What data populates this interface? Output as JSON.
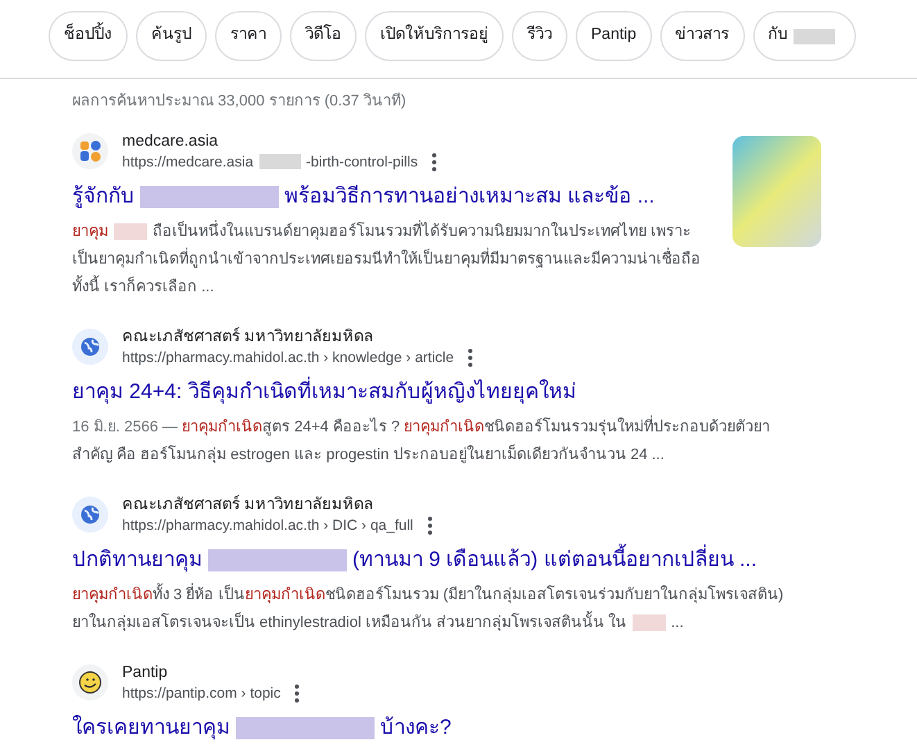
{
  "chips": [
    {
      "parts": [
        {
          "kind": "text",
          "text": "ช็อปปิ้ง"
        }
      ]
    },
    {
      "parts": [
        {
          "kind": "text",
          "text": "ค้นรูป"
        }
      ]
    },
    {
      "parts": [
        {
          "kind": "text",
          "text": "ราคา"
        }
      ]
    },
    {
      "parts": [
        {
          "kind": "text",
          "text": "วิดีโอ"
        }
      ]
    },
    {
      "parts": [
        {
          "kind": "text",
          "text": "เปิดให้บริการอยู่"
        }
      ]
    },
    {
      "parts": [
        {
          "kind": "text",
          "text": "รีวิว"
        }
      ]
    },
    {
      "parts": [
        {
          "kind": "text",
          "text": "Pantip"
        }
      ]
    },
    {
      "parts": [
        {
          "kind": "text",
          "text": "ข่าวสาร"
        }
      ]
    },
    {
      "parts": [
        {
          "kind": "text",
          "text": "กับ"
        },
        {
          "kind": "redacted"
        }
      ]
    }
  ],
  "result_stats": "ผลการค้นหาประมาณ 33,000 รายการ (0.37 วินาที)",
  "results": [
    {
      "kind": "pill",
      "site": "medcare.asia",
      "url": [
        {
          "kind": "text",
          "text": "https://medcare.asia"
        },
        {
          "kind": "redacted"
        },
        {
          "kind": "text",
          "text": "-birth-control-pills"
        }
      ],
      "thumbnail": true,
      "title": [
        {
          "kind": "text",
          "text": "รู้จักกับ"
        },
        {
          "kind": "redacted"
        },
        {
          "kind": "text",
          "text": "พร้อมวิธีการทานอย่างเหมาะสม และข้อ ..."
        }
      ],
      "snippet": [
        {
          "kind": "highlight",
          "text": "ยาคุม"
        },
        {
          "kind": "redacted"
        },
        {
          "kind": "text",
          "text": "ถือเป็นหนึ่งในแบรนด์ยาคุมฮอร์โมนรวมที่ได้รับความนิยมมากในประเทศไทย เพราะเป็นยาคุมกำเนิดที่ถูกนำเข้าจากประเทศเยอรมนีทำให้เป็นยาคุมที่มีมาตรฐานและมีความน่าเชื่อถือ ทั้งนี้ เราก็ควรเลือก ..."
        }
      ]
    },
    {
      "kind": "globe",
      "site": "คณะเภสัชศาสตร์ มหาวิทยาลัยมหิดล",
      "url": [
        {
          "kind": "text",
          "text": "https://pharmacy.mahidol.ac.th › knowledge › article"
        }
      ],
      "thumbnail": false,
      "title": [
        {
          "kind": "text",
          "text": "ยาคุม 24+4: วิธีคุมกำเนิดที่เหมาะสมกับผู้หญิงไทยยุคใหม่"
        }
      ],
      "snippet": [
        {
          "kind": "date",
          "text": "16 มิ.ย. 2566 — "
        },
        {
          "kind": "highlight",
          "text": "ยาคุมกำเนิด"
        },
        {
          "kind": "text",
          "text": "สูตร 24+4 คืออะไร ? "
        },
        {
          "kind": "highlight",
          "text": "ยาคุมกำเนิด"
        },
        {
          "kind": "text",
          "text": "ชนิดฮอร์โมนรวมรุ่นใหม่ที่ประกอบด้วยตัวยาสำคัญ คือ ฮอร์โมนกลุ่ม estrogen และ progestin ประกอบอยู่ในยาเม็ดเดียวกันจำนวน 24 ..."
        }
      ]
    },
    {
      "kind": "globe",
      "site": "คณะเภสัชศาสตร์ มหาวิทยาลัยมหิดล",
      "url": [
        {
          "kind": "text",
          "text": "https://pharmacy.mahidol.ac.th › DIC › qa_full"
        }
      ],
      "thumbnail": false,
      "title": [
        {
          "kind": "text",
          "text": "ปกติทานยาคุม"
        },
        {
          "kind": "redacted"
        },
        {
          "kind": "text",
          "text": "(ทานมา 9 เดือนแล้ว) แต่ตอนนี้อยากเปลี่ยน ..."
        }
      ],
      "snippet": [
        {
          "kind": "highlight",
          "text": "ยาคุมกำเนิด"
        },
        {
          "kind": "text",
          "text": "ทั้ง 3 ยี่ห้อ เป็น"
        },
        {
          "kind": "highlight",
          "text": "ยาคุมกำเนิด"
        },
        {
          "kind": "text",
          "text": "ชนิดฮอร์โมนรวม (มียาในกลุ่มเอสโตรเจนร่วมกับยาในกลุ่มโพรเจสติน) ยาในกลุ่มเอสโตรเจนจะเป็น ethinylestradiol เหมือนกัน ส่วนยากลุ่มโพรเจสตินนั้น ใน"
        },
        {
          "kind": "redacted"
        },
        {
          "kind": "text",
          "text": "..."
        }
      ]
    },
    {
      "kind": "smiley",
      "site": "Pantip",
      "url": [
        {
          "kind": "text",
          "text": "https://pantip.com › topic"
        }
      ],
      "thumbnail": false,
      "title": [
        {
          "kind": "text",
          "text": "ใครเคยทานยาคุม"
        },
        {
          "kind": "redacted"
        },
        {
          "kind": "text",
          "text": "บ้างคะ?"
        }
      ]
    }
  ]
}
